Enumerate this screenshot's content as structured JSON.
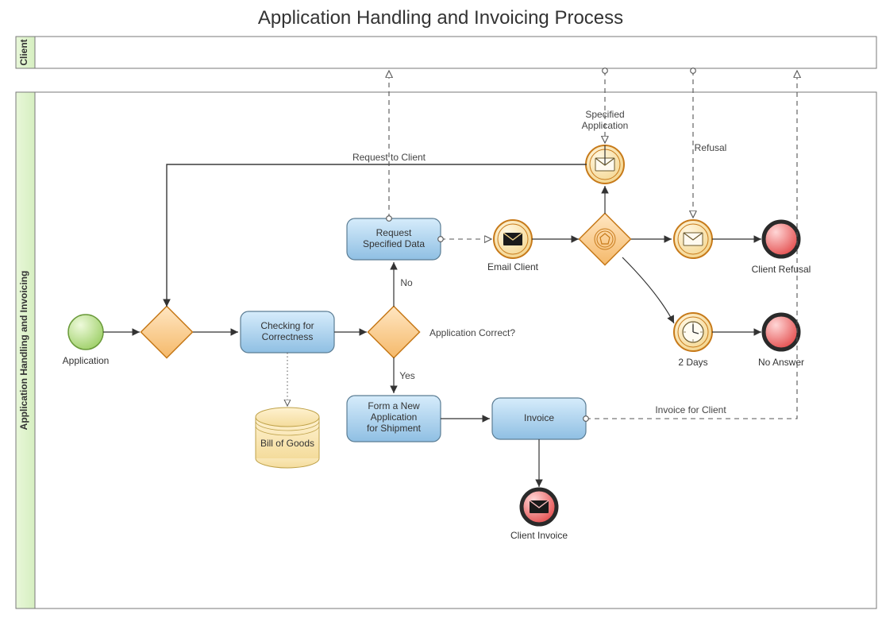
{
  "title": "Application Handling and Invoicing Process",
  "pools": {
    "client": "Client",
    "main": "Application Handling and Invoicing"
  },
  "nodes": {
    "start": "Application",
    "check": "Checking for Correctness",
    "request": "Request Specified Data",
    "form": "Form a New Application for Shipment",
    "invoice": "Invoice",
    "bill": "Bill of Goods",
    "emailClient": "Email Client",
    "twoDays": "2 Days",
    "noAnswer": "No Answer",
    "clientRefusal": "Client Refusal",
    "clientInvoice": "Client Invoice"
  },
  "labels": {
    "no": "No",
    "yes": "Yes",
    "appCorrect": "Application Correct?",
    "reqToClient": "Request to Client",
    "specApp": "Specified Application",
    "refusal": "Refusal",
    "invoiceFor": "Invoice for Client"
  }
}
